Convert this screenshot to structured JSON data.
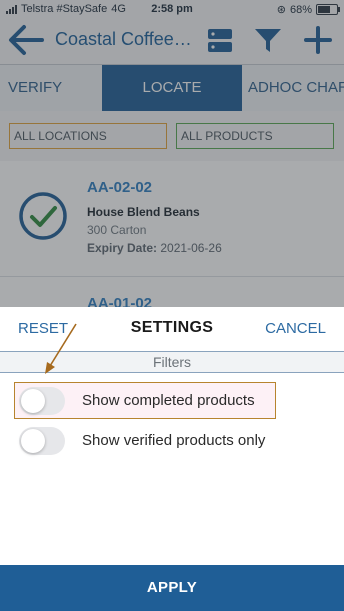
{
  "status_bar": {
    "carrier": "Telstra #StaySafe",
    "network": "4G",
    "time": "2:58 pm",
    "battery_percent": "68%",
    "battery_level": 0.68
  },
  "nav": {
    "title": "Coastal Coffee…",
    "icons": [
      "back-arrow-icon",
      "server-icon",
      "filter-icon",
      "plus-icon"
    ]
  },
  "tabs": [
    {
      "label": "VERIFY",
      "active": false
    },
    {
      "label": "LOCATE",
      "active": true
    },
    {
      "label": "ADHOC CHAR",
      "active": false
    }
  ],
  "filters": {
    "locations": "ALL LOCATIONS",
    "products": "ALL PRODUCTS"
  },
  "cards": [
    {
      "code": "AA-02-02",
      "name": "House Blend Beans",
      "qty": "300 Carton",
      "expiry_label": "Expiry Date:",
      "expiry_value": "2021-06-26",
      "verified": true
    },
    {
      "code": "AA-01-02"
    }
  ],
  "settings": {
    "reset_label": "RESET",
    "title": "SETTINGS",
    "cancel_label": "CANCEL",
    "section_label": "Filters",
    "options": [
      {
        "label": "Show completed products",
        "enabled": false,
        "highlighted": true
      },
      {
        "label": "Show verified products only",
        "enabled": false,
        "highlighted": false
      }
    ],
    "apply_label": "APPLY"
  },
  "colors": {
    "primary": "#1f5e96",
    "link": "#2c6aa2",
    "location_border": "#e0a33c",
    "product_border": "#58a852",
    "check": "#2e8b3e",
    "annotation": "#a66a1e"
  }
}
